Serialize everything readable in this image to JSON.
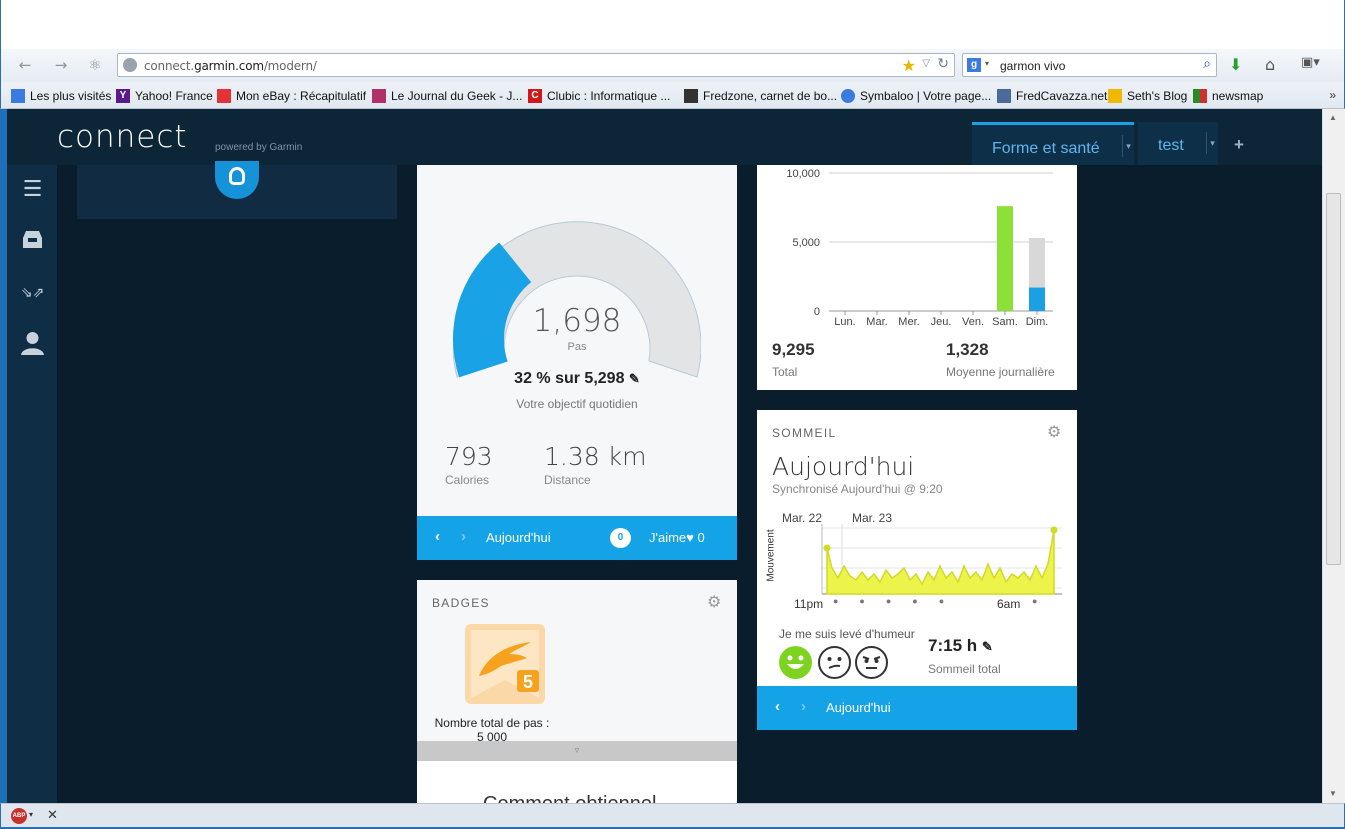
{
  "browser": {
    "url_prefix": "connect.",
    "url_domain": "garmin.com",
    "url_path": "/modern/",
    "search_query": "garmon vivo",
    "bookmarks": [
      {
        "label": "Les plus visités",
        "color": "#3a7be0"
      },
      {
        "label": "Yahoo! France",
        "color": "#5a1a8a"
      },
      {
        "label": "Mon eBay : Récapitulatif",
        "color": "#e53238"
      },
      {
        "label": "Le Journal du Geek - J...",
        "color": "#b0306a"
      },
      {
        "label": "Clubic : Informatique ...",
        "color": "#d01818"
      },
      {
        "label": "Fredzone, carnet de bo...",
        "color": "#333333"
      },
      {
        "label": "Symbaloo | Votre page...",
        "color": "#3a7be0"
      },
      {
        "label": "FredCavazza.net",
        "color": "#4a6a9a"
      },
      {
        "label": "Seth's Blog",
        "color": "#f0b800"
      },
      {
        "label": "newsmap",
        "color": "#2a8a2a"
      }
    ],
    "bookmarks_more": "»"
  },
  "app": {
    "logo": "connect",
    "powered": "powered by Garmin",
    "tabs": [
      {
        "label": "Forme et santé"
      },
      {
        "label": "test"
      }
    ],
    "tab_add": "+"
  },
  "steps": {
    "value": "1,698",
    "unit": "Pas",
    "goal_line": "32 % sur 5,298",
    "goal_sub": "Votre objectif quotidien",
    "progress": 0.32,
    "calories_value": "793",
    "calories_label": "Calories",
    "distance_value": "1.38 km",
    "distance_label": "Distance",
    "day_label": "Aujourd'hui",
    "comments_count": "0",
    "like_label": "J'aime",
    "like_count": "0"
  },
  "badges": {
    "title": "BADGES",
    "badge_number": "5",
    "badge_label": "Nombre total de pas :",
    "badge_value": "5 000",
    "more_glyph": "▿",
    "cut_text": "Comment obtiennel..."
  },
  "weekly": {
    "total_value": "9,295",
    "total_label": "Total",
    "avg_value": "1,328",
    "avg_label": "Moyenne journalière"
  },
  "chart_data": {
    "type": "bar",
    "categories": [
      "Lun.",
      "Mar.",
      "Mer.",
      "Jeu.",
      "Ven.",
      "Sam.",
      "Dim."
    ],
    "series": [
      {
        "values": [
          0,
          0,
          0,
          0,
          0,
          7597,
          1698
        ],
        "color_by_day": [
          "#8be03a",
          "#8be03a",
          "#8be03a",
          "#8be03a",
          "#8be03a",
          "#8be03a",
          "#1ca0e4"
        ]
      },
      {
        "values": [
          0,
          0,
          0,
          0,
          0,
          0,
          5298
        ],
        "color": "#d8d8d8"
      }
    ],
    "yticks": [
      "10,000",
      "5,000",
      "0"
    ],
    "ylim": [
      0,
      10000
    ]
  },
  "sleep": {
    "title": "SOMMEIL",
    "heading": "Aujourd'hui",
    "sync": "Synchronisé Aujourd'hui @ 9:20",
    "date1": "Mar. 22",
    "date2": "Mar. 23",
    "ylabel": "Mouvement",
    "time_start": "11pm",
    "time_mid": "6am",
    "mood_label": "Je me suis levé d'humeur",
    "total_value": "7:15 h",
    "total_label": "Sommeil total",
    "day_label": "Aujourd'hui"
  }
}
